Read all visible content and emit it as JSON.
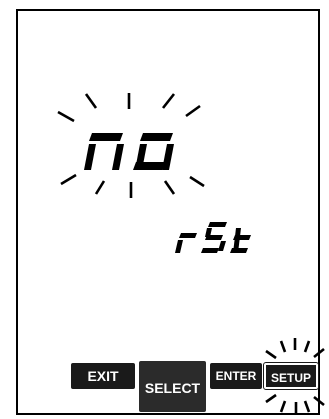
{
  "display": {
    "main_text": "no",
    "main_blinking": true,
    "sub_text": "rSt"
  },
  "buttons": {
    "exit": "EXIT",
    "select": "SELECT",
    "enter": "ENTER",
    "setup": "SETUP",
    "setup_blinking": true
  },
  "colors": {
    "segments": "#000000",
    "background": "#ffffff",
    "button_fill": "#1a1a1a",
    "button_text": "#ffffff"
  }
}
